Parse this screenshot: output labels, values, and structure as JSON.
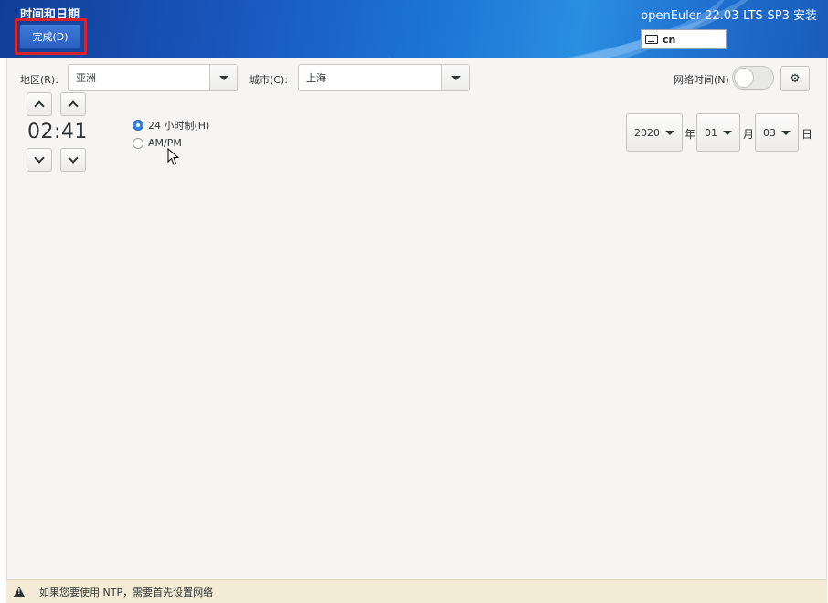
{
  "header": {
    "title": "时间和日期",
    "done_label": "完成(D)",
    "product": "openEuler 22.03-LTS-SP3 安装",
    "keyboard_layout": "cn"
  },
  "location": {
    "region_label": "地区(R):",
    "region_value": "亚洲",
    "city_label": "城市(C):",
    "city_value": "上海"
  },
  "network_time": {
    "label": "网络时间(N)",
    "enabled": false
  },
  "time": {
    "hours": "02",
    "separator": ":",
    "minutes": "41",
    "format_24h_label": "24 小时制(H)",
    "format_ampm_label": "AM/PM",
    "selected_format": "24h"
  },
  "date": {
    "year": "2020",
    "year_unit": "年",
    "month": "01",
    "month_unit": "月",
    "day": "03",
    "day_unit": "日"
  },
  "footer": {
    "warning": "如果您要使用 NTP，需要首先设置网络"
  },
  "colors": {
    "accent": "#3584e4",
    "header": "#1d6fd0",
    "highlight": "#d8232a",
    "warning_bar": "#f3ebd6"
  }
}
